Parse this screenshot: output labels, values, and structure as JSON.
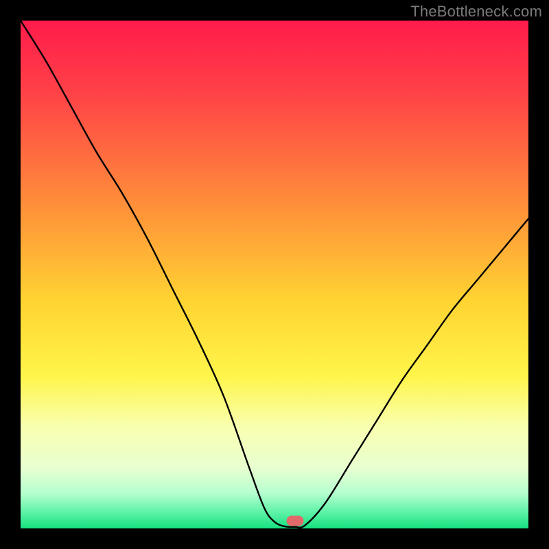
{
  "watermark": "TheBottleneck.com",
  "gradient": {
    "stops": [
      {
        "offset": "0%",
        "color": "#ff1b4b"
      },
      {
        "offset": "15%",
        "color": "#ff4447"
      },
      {
        "offset": "35%",
        "color": "#ff8a3a"
      },
      {
        "offset": "55%",
        "color": "#ffd332"
      },
      {
        "offset": "70%",
        "color": "#fff54a"
      },
      {
        "offset": "80%",
        "color": "#f8ffb0"
      },
      {
        "offset": "88%",
        "color": "#e9ffd0"
      },
      {
        "offset": "93%",
        "color": "#b6ffcf"
      },
      {
        "offset": "97%",
        "color": "#5af2a5"
      },
      {
        "offset": "100%",
        "color": "#16e07f"
      }
    ]
  },
  "curve": {
    "stroke": "#000000",
    "stroke_width": 2.4
  },
  "marker": {
    "color": "#e06a6a",
    "x_frac": 0.54,
    "y_frac": 0.985
  },
  "chart_data": {
    "type": "line",
    "title": "",
    "xlabel": "",
    "ylabel": "",
    "xlim": [
      0,
      100
    ],
    "ylim": [
      0,
      100
    ],
    "series": [
      {
        "name": "bottleneck-curve",
        "x": [
          0,
          5,
          10,
          15,
          20,
          25,
          30,
          35,
          40,
          45,
          48,
          50,
          52,
          54,
          56,
          60,
          65,
          70,
          75,
          80,
          85,
          90,
          95,
          100
        ],
        "y": [
          100,
          92,
          83,
          74,
          66,
          57,
          47,
          37,
          26,
          12,
          4,
          1.3,
          0.4,
          0.3,
          0.6,
          5,
          13,
          21,
          29,
          36,
          43,
          49,
          55,
          61
        ]
      }
    ],
    "annotations": [
      {
        "name": "optimal-point",
        "x": 54,
        "y": 1.5
      }
    ],
    "watermark": "TheBottleneck.com"
  }
}
